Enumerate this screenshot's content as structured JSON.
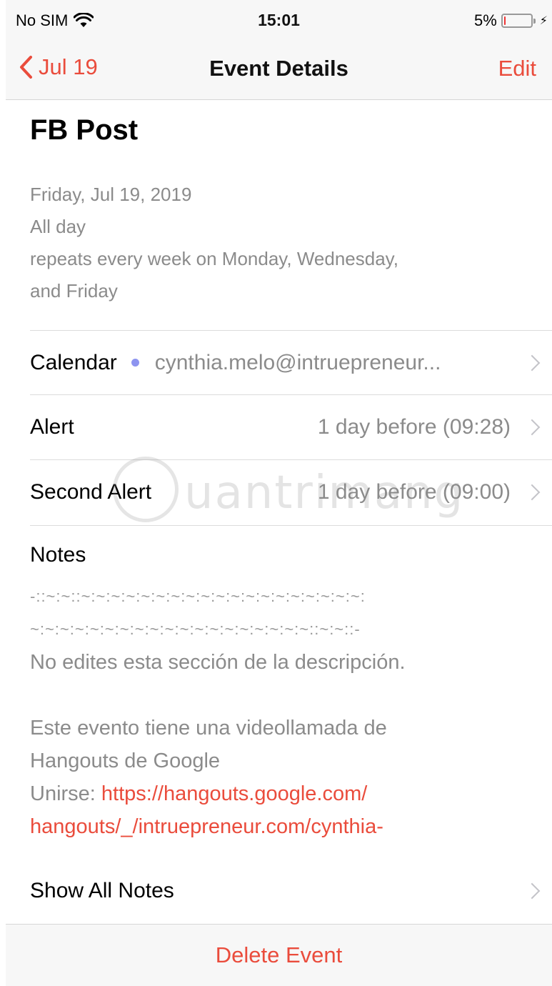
{
  "status_bar": {
    "carrier": "No SIM",
    "time": "15:01",
    "battery_percent": "5%",
    "battery_level": 0.05,
    "charging_glyph": "⚡"
  },
  "nav": {
    "back_label": "Jul 19",
    "title": "Event Details",
    "edit_label": "Edit"
  },
  "event": {
    "title": "FB Post",
    "date": "Friday, Jul 19, 2019",
    "time": "All day",
    "repeat_line1": "repeats every week on Monday, Wednesday,",
    "repeat_line2": "and Friday"
  },
  "rows": {
    "calendar": {
      "label": "Calendar",
      "value": "cynthia.melo@intruepreneur...",
      "dot_color": "#8d94f0"
    },
    "alert": {
      "label": "Alert",
      "value": "1 day before (09:28)"
    },
    "second_alert": {
      "label": "Second Alert",
      "value": "1 day before (09:00)"
    }
  },
  "notes": {
    "label": "Notes",
    "separator1": "-::~:~::~:~:~:~:~:~:~:~:~:~:~:~:~:~:~:~:~:~:~:",
    "separator2": "~:~:~:~:~:~:~:~:~:~:~:~:~:~:~:~:~:~:~::~:~::-",
    "line1": "No edites esta sección de la descripción.",
    "line2": "Este evento tiene una videollamada de",
    "line3": "Hangouts de Google",
    "join_label": "Unirse: ",
    "link_part1": "https://hangouts.google.com/",
    "link_part2": "hangouts/_/intruepreneur.com/cynthia-"
  },
  "show_all_notes": "Show All Notes",
  "delete_label": "Delete Event",
  "watermark_text": "uantrimang",
  "colors": {
    "accent": "#ea4c3c",
    "secondary_text": "#8b8b8b",
    "bar_background": "#f7f7f7"
  }
}
